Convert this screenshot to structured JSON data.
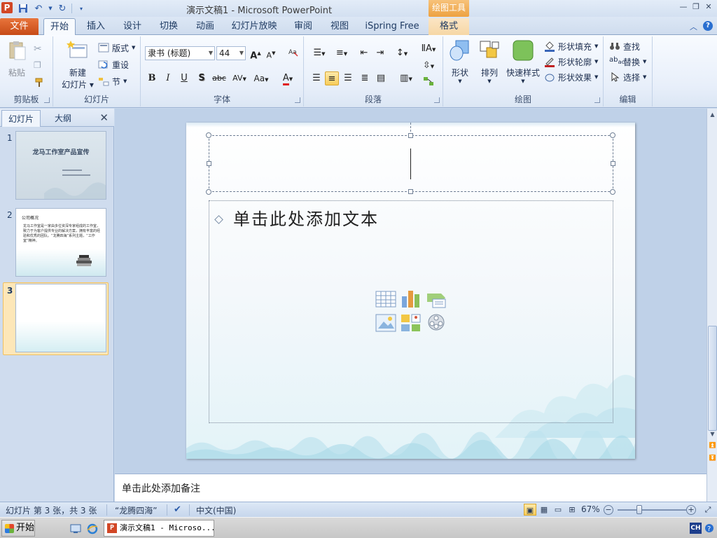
{
  "titlebar": {
    "app_icon": "P",
    "title": "演示文稿1 - Microsoft PowerPoint",
    "contextual_tab_title": "绘图工具",
    "qat_icons": [
      "save-icon",
      "undo-icon",
      "redo-icon",
      "customize-icon"
    ]
  },
  "tabs": {
    "file": "文件",
    "home": "开始",
    "insert": "插入",
    "design": "设计",
    "transitions": "切换",
    "animations": "动画",
    "slideshow": "幻灯片放映",
    "review": "审阅",
    "view": "视图",
    "ispring": "iSpring Free",
    "format": "格式"
  },
  "ribbon": {
    "clipboard": {
      "label": "剪贴板",
      "paste": "粘贴"
    },
    "slides": {
      "label": "幻灯片",
      "new_slide_1": "新建",
      "new_slide_2": "幻灯片",
      "layout": "版式",
      "reset": "重设",
      "section": "节"
    },
    "font": {
      "label": "字体",
      "font_name": "隶书 (标题)",
      "font_size": "44",
      "bold": "B",
      "italic": "I",
      "underline": "U",
      "shadow": "S",
      "strike": "abc",
      "spacing": "AV",
      "case": "Aa",
      "color": "A"
    },
    "paragraph": {
      "label": "段落"
    },
    "drawing": {
      "label": "绘图",
      "shapes": "形状",
      "arrange": "排列",
      "quick_styles": "快速样式",
      "fill": "形状填充",
      "outline": "形状轮廓",
      "effects": "形状效果"
    },
    "editing": {
      "label": "编辑",
      "find": "查找",
      "replace": "替换",
      "select": "选择"
    }
  },
  "left_pane": {
    "tab_slides": "幻灯片",
    "tab_outline": "大纲",
    "close": "✕",
    "thumbs": [
      {
        "num": "1",
        "title": "龙马工作室产品宣传"
      },
      {
        "num": "2",
        "heading": "公司概况",
        "body": "龙马工作室是一家由多位资深专家组成的工作室，致力于为客户提供专业的解决方案，拥有丰富的经验和优秀的团队。“龙腾四海”系列主题，“工作室”精神。"
      },
      {
        "num": "3"
      }
    ]
  },
  "slide": {
    "content_placeholder": "单击此处添加文本"
  },
  "notes": {
    "placeholder": "单击此处添加备注"
  },
  "status": {
    "slide_info": "幻灯片 第 3 张，共 3 张",
    "theme": "“龙腾四海”",
    "language": "中文(中国)",
    "zoom": "67%"
  },
  "taskbar": {
    "start": "开始",
    "task": "演示文稿1 - Microso...",
    "ime": "CH"
  }
}
